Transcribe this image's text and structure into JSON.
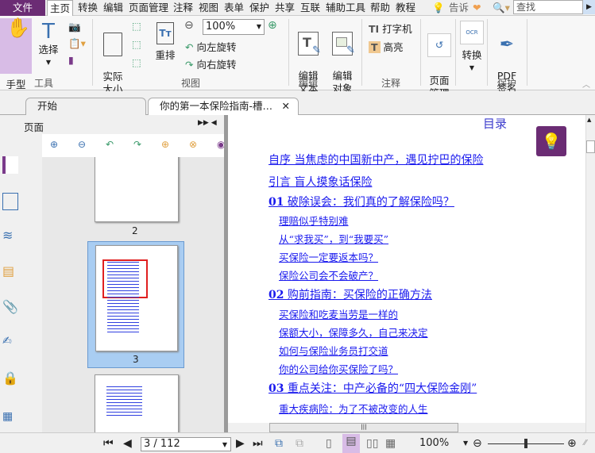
{
  "menu": {
    "file": "文件",
    "items": [
      "主页",
      "转换",
      "编辑",
      "页面管理",
      "注释",
      "视图",
      "表单",
      "保护",
      "共享",
      "互联",
      "辅助工具",
      "帮助",
      "教程"
    ],
    "tell": "告诉",
    "search_placeholder": "查找"
  },
  "ribbon": {
    "hand": "手型\n工具",
    "select": "选择",
    "tools_group": "工具",
    "actual_size": "实际\n大小",
    "reflow": "重排",
    "zoom_value": "100%",
    "rotate_left": "向左旋转",
    "rotate_right": "向右旋转",
    "view_group": "视图",
    "edit_text": "编辑\n文本",
    "edit_object": "编辑\n对象",
    "edit_group": "编辑",
    "typewriter": "打字机",
    "highlight": "高亮",
    "comment_group": "注释",
    "page_manage": "页面\n管理",
    "convert": "转换",
    "pdf_sign": "PDF\n签名",
    "protect_group": "保护"
  },
  "tabs": [
    {
      "label": "开始"
    },
    {
      "label": "你的第一本保险指南-槽…"
    }
  ],
  "panel": {
    "title": "页面",
    "thumb_labels": [
      "2",
      "3"
    ],
    "selected_page": "3"
  },
  "document": {
    "title": "目录",
    "toc": [
      {
        "level": 1,
        "text": "自序 当焦虑的中国新中产，遇见拧巴的保险"
      },
      {
        "level": 1,
        "text": "引言 盲人摸象话保险"
      },
      {
        "level": 1,
        "num": "01",
        "text": " 破除误会：我们真的了解保险吗？"
      },
      {
        "level": 2,
        "text": "理赔似乎特别难"
      },
      {
        "level": 2,
        "text": "从“求我买”，到“我要买”"
      },
      {
        "level": 2,
        "text": "买保险一定要返本吗？"
      },
      {
        "level": 2,
        "text": "保险公司会不会破产？"
      },
      {
        "level": 1,
        "num": "02",
        "text": " 购前指南：买保险的正确方法"
      },
      {
        "level": 2,
        "text": "买保险和吃麦当劳是一样的"
      },
      {
        "level": 2,
        "text": "保额大小，保障多久，自己来决定"
      },
      {
        "level": 2,
        "text": "如何与保险业务员打交道"
      },
      {
        "level": 2,
        "text": "你的公司给你买保险了吗？"
      },
      {
        "level": 1,
        "num": "03",
        "text": " 重点关注：中产必备的“四大保险金刚”"
      },
      {
        "level": 2,
        "text": "重大疾病险：为了不被改变的人生"
      }
    ]
  },
  "status": {
    "page": "3 / 112",
    "zoom": "100%",
    "zoom_slider_percent": 50
  },
  "colors": {
    "accent": "#6b2c74",
    "link": "#1a1aee",
    "selected": "#d8bce6"
  }
}
